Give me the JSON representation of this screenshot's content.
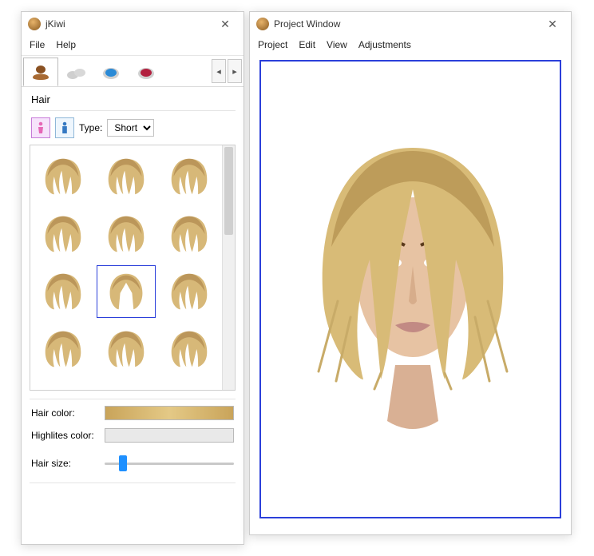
{
  "left_window": {
    "title": "jKiwi",
    "menu": {
      "file": "File",
      "help": "Help"
    },
    "tabs": {
      "hair": "hair-tab",
      "face": "face-tab",
      "eye": "eye-tab",
      "lip": "lip-tab"
    },
    "section_label": "Hair",
    "type_label": "Type:",
    "type_value": "Short",
    "gallery": {
      "count": 12,
      "selected_index": 7
    },
    "hair_color_label": "Hair color:",
    "highlights_label": "Highlites color:",
    "hair_size_label": "Hair size:",
    "hair_color": "#d6b56a",
    "highlights_color": "#e9e9e9",
    "slider_percent": 12
  },
  "right_window": {
    "title": "Project Window",
    "menu": {
      "project": "Project",
      "edit": "Edit",
      "view": "View",
      "adjustments": "Adjustments"
    }
  }
}
